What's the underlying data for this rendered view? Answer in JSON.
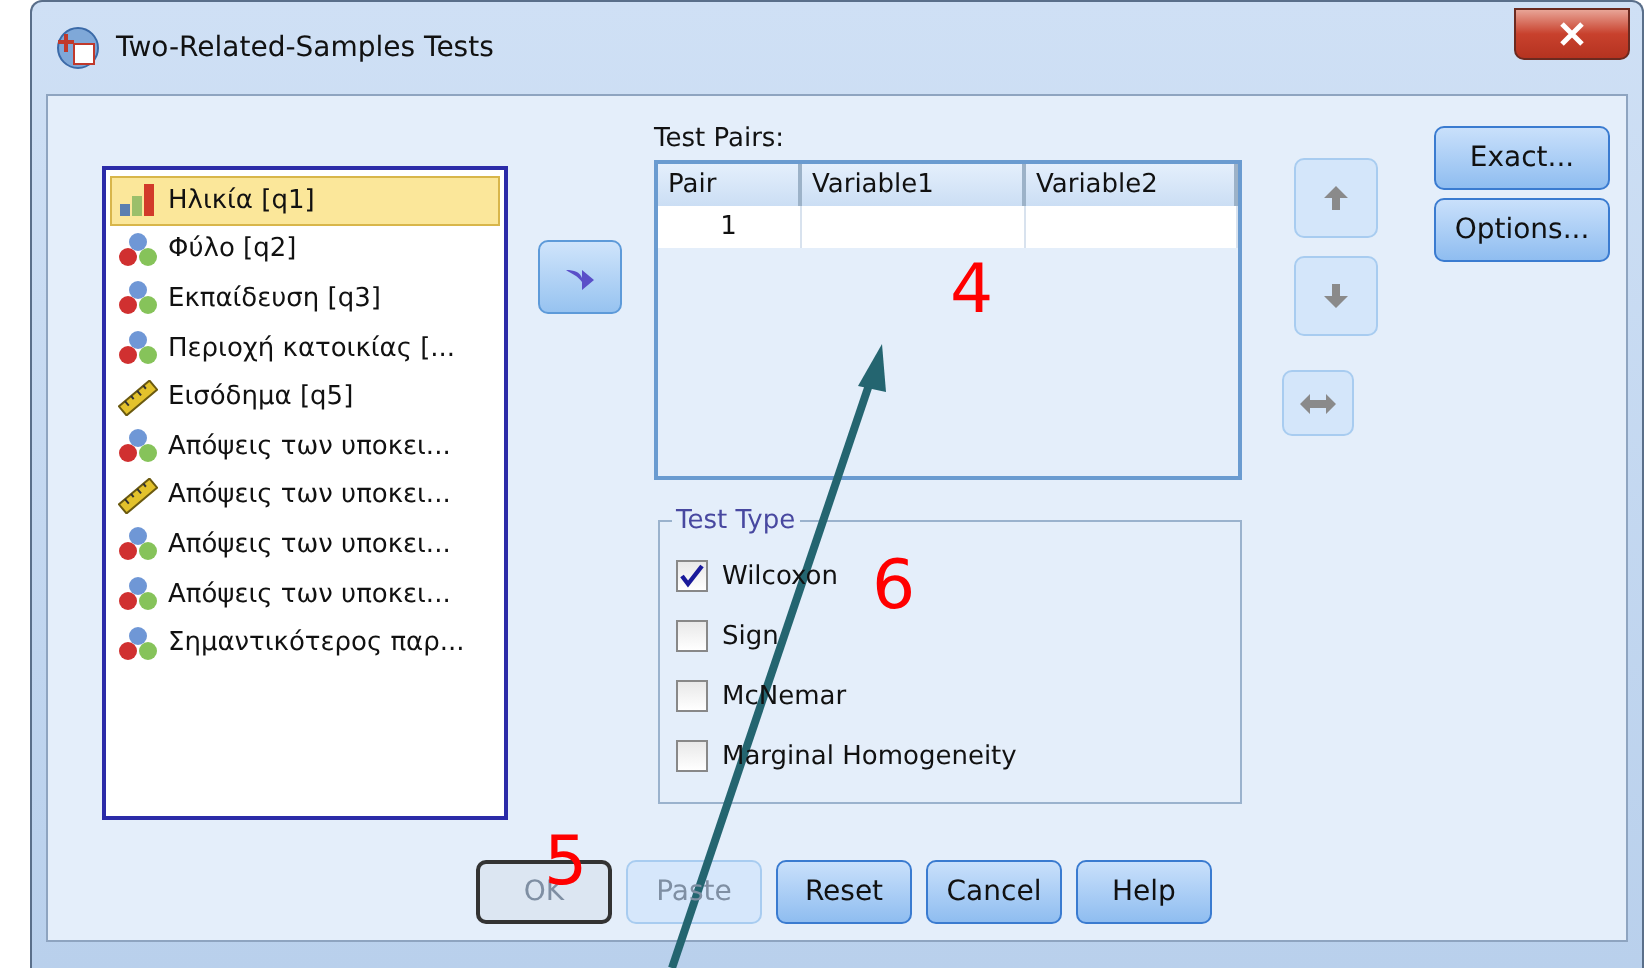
{
  "window": {
    "title": "Two-Related-Samples Tests"
  },
  "variables": [
    {
      "label": "Ηλικία [q1]",
      "kind": "ordinal",
      "selected": true
    },
    {
      "label": "Φύλο [q2]",
      "kind": "nominal",
      "selected": false
    },
    {
      "label": "Εκπαίδευση [q3]",
      "kind": "nominal",
      "selected": false
    },
    {
      "label": "Περιοχή κατοικίας [...",
      "kind": "nominal",
      "selected": false
    },
    {
      "label": "Εισόδημα [q5]",
      "kind": "scale",
      "selected": false
    },
    {
      "label": "Απόψεις των υποκει...",
      "kind": "nominal",
      "selected": false
    },
    {
      "label": "Απόψεις των υποκει...",
      "kind": "scale",
      "selected": false
    },
    {
      "label": "Απόψεις των υποκει...",
      "kind": "nominal",
      "selected": false
    },
    {
      "label": "Απόψεις των υποκει...",
      "kind": "nominal",
      "selected": false
    },
    {
      "label": "Σημαντικότερος παρ...",
      "kind": "nominal",
      "selected": false
    }
  ],
  "test_pairs": {
    "label": "Test Pairs:",
    "columns": [
      "Pair",
      "Variable1",
      "Variable2"
    ],
    "rows": [
      [
        "1",
        "",
        ""
      ]
    ]
  },
  "order_buttons": [
    {
      "kind": "up",
      "disabled": true
    },
    {
      "kind": "down",
      "disabled": true
    },
    {
      "kind": "swap",
      "disabled": true
    }
  ],
  "side_buttons": [
    "Exact...",
    "Options..."
  ],
  "test_type": {
    "label": "Test Type",
    "options": [
      {
        "label": "Wilcoxon",
        "checked": true
      },
      {
        "label": "Sign",
        "checked": false
      },
      {
        "label": "McNemar",
        "checked": false
      },
      {
        "label": "Marginal Homogeneity",
        "checked": false
      }
    ]
  },
  "buttons": [
    {
      "label": "OK",
      "disabled": true,
      "default": true
    },
    {
      "label": "Paste",
      "disabled": true,
      "default": false
    },
    {
      "label": "Reset",
      "disabled": false,
      "default": false
    },
    {
      "label": "Cancel",
      "disabled": false,
      "default": false
    },
    {
      "label": "Help",
      "disabled": false,
      "default": false
    }
  ],
  "annotations": [
    "4",
    "5",
    "6"
  ]
}
